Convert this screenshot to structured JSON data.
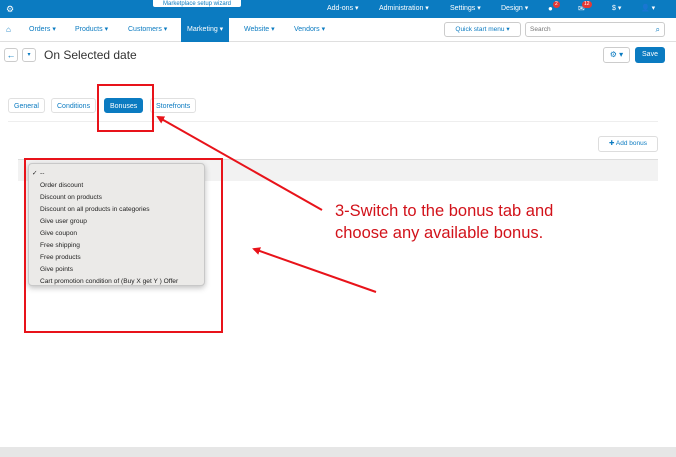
{
  "topbar": {
    "wizard_label": "Marketplace setup wizard",
    "menus": [
      "Add-ons",
      "Administration",
      "Settings",
      "Design"
    ],
    "notif_count": "2",
    "messages_count": "12",
    "currency": "$"
  },
  "nav": {
    "items": [
      "Orders",
      "Products",
      "Customers",
      "Marketing",
      "Website",
      "Vendors"
    ],
    "active": "Marketing",
    "quick_menu": "Quick start menu",
    "search_placeholder": "Search"
  },
  "header": {
    "title": "On Selected date",
    "save_label": "Save"
  },
  "tabs": [
    "General",
    "Conditions",
    "Bonuses",
    "Storefronts"
  ],
  "active_tab": "Bonuses",
  "add_bonus_label": "Add bonus",
  "dropdown": {
    "options": [
      "--",
      "Order discount",
      "Discount on products",
      "Discount on all products in categories",
      "Give user group",
      "Give coupon",
      "Free shipping",
      "Free products",
      "Give points",
      "Cart promotion condition of (Buy X get Y ) Offer"
    ],
    "selected": "--"
  },
  "annotation": {
    "line1": "3-Switch to the bonus tab and",
    "line2": "choose any available bonus."
  },
  "colors": {
    "accent": "#0b7bc1",
    "annotation": "#e8131a"
  }
}
